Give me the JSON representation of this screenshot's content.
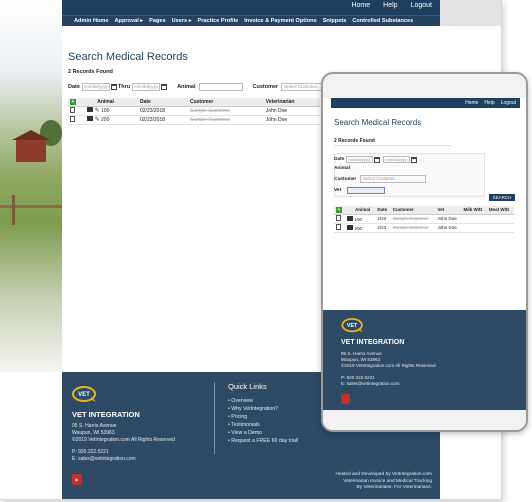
{
  "desktop": {
    "topbar": {
      "links": [
        "Home",
        "Help",
        "Logout"
      ]
    },
    "nav": [
      "Admin Home",
      "Approval ▸",
      "Pages",
      "Users ▸",
      "Practice Profile",
      "Invoice & Payment Options",
      "Snippets",
      "Controlled Substances"
    ],
    "page_title": "Search Medical Records",
    "records_found": "2 Records Found",
    "filters": {
      "date_label": "Date",
      "date_placeholder": "mm/dd/yyyy",
      "thru_label": "Thru",
      "thru_placeholder": "mm/dd/yyyy",
      "animal_label": "Animal",
      "customer_label": "Customer",
      "customer_placeholder": "Select Customer...",
      "vet_label": "V"
    },
    "table": {
      "headers": [
        "",
        "Animal",
        "Date",
        "Customer",
        "Veterinarian"
      ],
      "rows": [
        {
          "animal": "100",
          "date": "02/23/2018",
          "customer": "Sample Customer",
          "vet": "John Doe"
        },
        {
          "animal": "200",
          "date": "02/23/2018",
          "customer": "Sample Customer",
          "vet": "John Doe"
        }
      ]
    },
    "footer": {
      "logo": "VET INTEGRATION",
      "company": "VET INTEGRATION",
      "address": [
        "95 S. Harris Avenue",
        "Waupun, WI 53963",
        "©2019 VetIntegration.com All Rights Reserved"
      ],
      "phone": "P: 920.322.5221",
      "email": "E: sales@vetintegration.com",
      "quick_links_title": "Quick Links",
      "quick_links": [
        "Overview",
        "Why VetIntegration?",
        "Pricing",
        "Testimonials",
        "View a Demo",
        "Request a FREE 60 day trial!"
      ],
      "credit": [
        "Hosted and Developed by VetIntegration.com",
        "Veterinarian Invoice and Medical Tracking",
        "By Veterinarians. For Veterinarians."
      ]
    }
  },
  "mobile": {
    "topbar": {
      "links": [
        "Home",
        "Help",
        "Logout"
      ]
    },
    "page_title": "Search Medical Records",
    "records_found": "2 Records Found",
    "filters": {
      "date_label": "Date",
      "date_placeholder": "mm/dd/yyyy",
      "thru_placeholder": "mm/dd/yyyy",
      "animal_label": "Animal",
      "customer_label": "Customer",
      "customer_placeholder": "Select Customer...",
      "vet_label": "Vet",
      "search_button": "SEARCH"
    },
    "table": {
      "headers": [
        "",
        "Animal",
        "Date",
        "Customer",
        "Vet",
        "Milk W/D",
        "Meat W/D"
      ],
      "rows": [
        {
          "animal": "100",
          "date": "2/23",
          "customer": "Sample Customer",
          "vet": "John Doe"
        },
        {
          "animal": "200",
          "date": "2/23",
          "customer": "Sample Customer",
          "vet": "John Doe"
        }
      ]
    },
    "footer": {
      "company": "VET INTEGRATION",
      "address": [
        "95 S. Harris Avenue",
        "Waupun, WI 53963",
        "©2019 VetIntegration.com All Rights Reserved"
      ],
      "phone": "P: 920.322.5221",
      "email": "E: sales@vetintegration.com"
    }
  },
  "colors": {
    "navy": "#1f3f5f",
    "footer": "#2e4a65",
    "youtube": "#c4302b",
    "logo_yellow": "#e5b526"
  }
}
